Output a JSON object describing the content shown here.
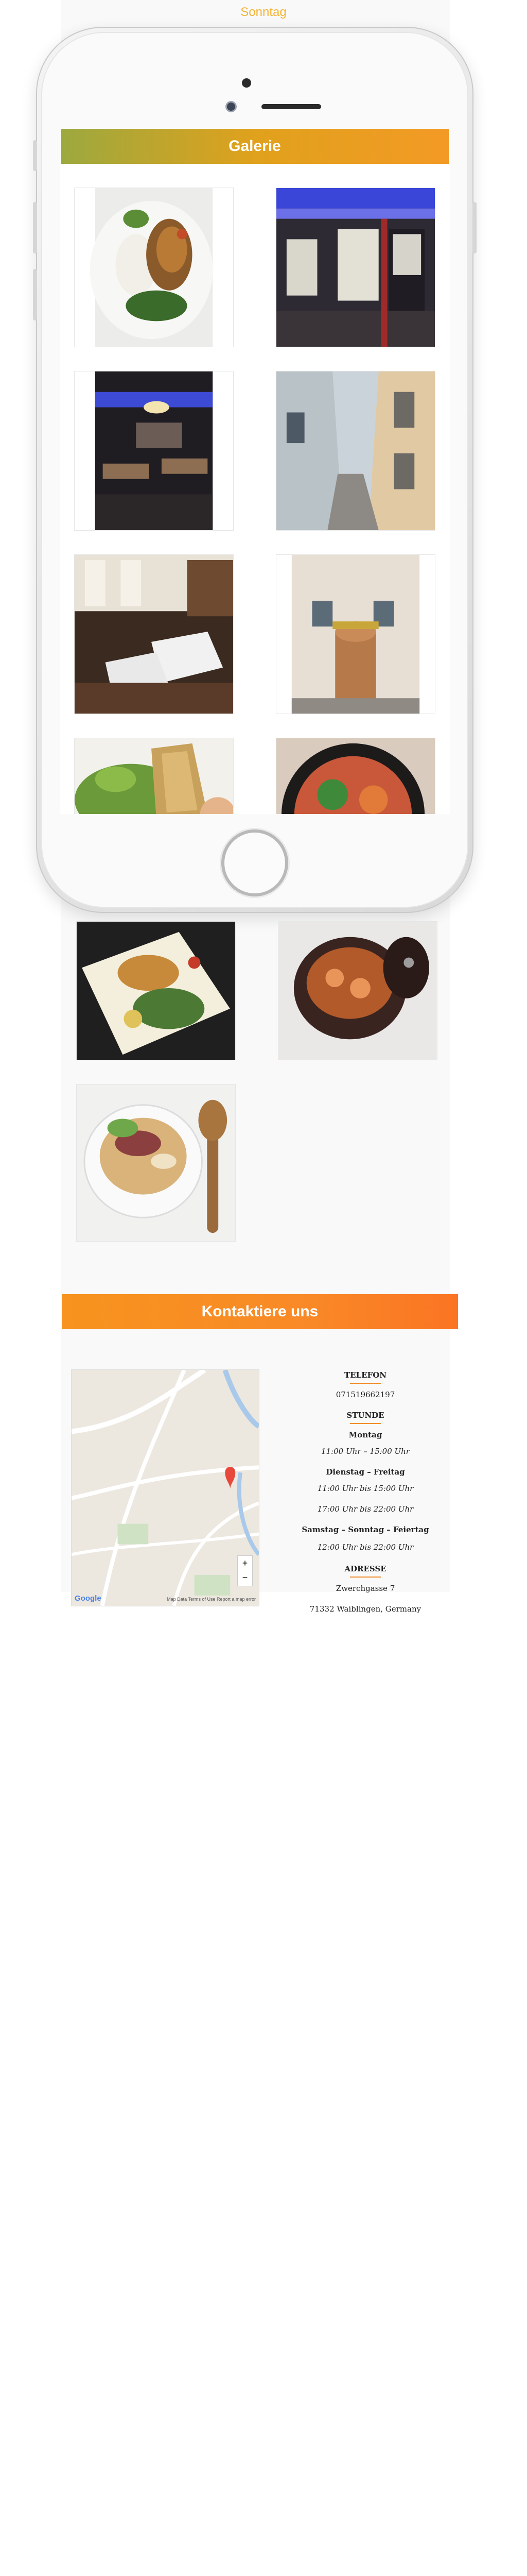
{
  "header": {
    "previous_day_label": "Sonntag"
  },
  "gallery": {
    "title": "Galerie",
    "items": [
      "Salatteller",
      "Restaurant Eingang innen",
      "Gastraum",
      "Gasse",
      "Gastraum Tische",
      "Hauseingang",
      "Frühlingsrollen",
      "Nudelgericht",
      "Reisgericht",
      "Garnelen im Tontopf",
      "Pho Suppe"
    ]
  },
  "contact": {
    "title": "Kontaktiere uns",
    "phone_heading": "TELEFON",
    "phone_number": "071519662197",
    "hours_heading": "STUNDE",
    "hours": [
      {
        "day": "Montag",
        "times": [
          "11:00 Uhr – 15:00 Uhr"
        ]
      },
      {
        "day": "Dienstag – Freitag",
        "times": [
          "11:00 Uhr bis 15:00 Uhr",
          "17:00 Uhr bis 22:00 Uhr"
        ]
      },
      {
        "day": "Samstag – Sonntag – Feiertag",
        "times": [
          "12:00 Uhr bis 22:00 Uhr"
        ]
      }
    ],
    "address_heading": "ADRESSE",
    "address_line1": "Zwerchgasse 7",
    "address_line2": "71332 Waiblingen, Germany"
  },
  "map": {
    "zoom_in": "+",
    "zoom_out": "−",
    "google_logo": "Google",
    "footer_text": "Map Data   Terms of Use   Report a map error",
    "marker_color": "#e8483c"
  }
}
